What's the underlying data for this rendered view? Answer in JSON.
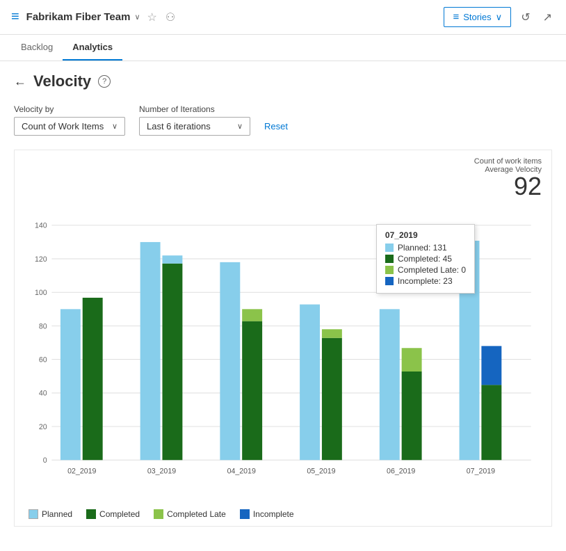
{
  "header": {
    "team_name": "Fabrikam Fiber Team",
    "icon": "≡",
    "chevron": "∨",
    "star": "☆",
    "team_icon": "⚇",
    "stories_label": "Stories",
    "stories_chevron": "∨",
    "refresh_icon": "↺",
    "expand_icon": "↗"
  },
  "nav": {
    "tabs": [
      {
        "id": "backlog",
        "label": "Backlog",
        "active": false
      },
      {
        "id": "analytics",
        "label": "Analytics",
        "active": true
      }
    ]
  },
  "page": {
    "back_label": "←",
    "title": "Velocity",
    "help_label": "?",
    "velocity_by_label": "Velocity by",
    "number_of_iterations_label": "Number of Iterations",
    "velocity_by_value": "Count of Work Items",
    "number_of_iterations_value": "Last 6 iterations",
    "reset_label": "Reset",
    "chart_metric_label": "Count of work items",
    "chart_avg_label": "Average Velocity",
    "chart_avg_value": "92"
  },
  "chart": {
    "y_ticks": [
      0,
      20,
      40,
      60,
      80,
      100,
      120,
      140
    ],
    "groups": [
      {
        "label": "02_2019",
        "planned": 90,
        "completed": 97,
        "completed_late": 0,
        "incomplete": 0
      },
      {
        "label": "03_2019",
        "planned": 130,
        "completed": 117,
        "completed_late": 0,
        "incomplete": 0
      },
      {
        "label": "04_2019",
        "planned": 118,
        "completed": 83,
        "completed_late": 90,
        "incomplete": 0
      },
      {
        "label": "05_2019",
        "planned": 93,
        "completed": 73,
        "completed_late": 78,
        "incomplete": 0
      },
      {
        "label": "06_2019",
        "planned": 90,
        "completed": 53,
        "completed_late": 67,
        "incomplete": 0
      },
      {
        "label": "07_2019",
        "planned": 131,
        "completed": 45,
        "completed_late": 0,
        "incomplete": 23
      }
    ],
    "tooltip": {
      "label": "07_2019",
      "planned": 131,
      "completed": 45,
      "completed_late": 0,
      "incomplete": 23
    },
    "colors": {
      "planned": "#87ceeb",
      "completed": "#1a6b1a",
      "completed_late": "#8bc34a",
      "incomplete": "#1565c0"
    },
    "legend": [
      {
        "id": "planned",
        "label": "Planned",
        "color": "#87ceeb"
      },
      {
        "id": "completed",
        "label": "Completed",
        "color": "#1a6b1a"
      },
      {
        "id": "completed_late",
        "label": "Completed Late",
        "color": "#8bc34a"
      },
      {
        "id": "incomplete",
        "label": "Incomplete",
        "color": "#1565c0"
      }
    ]
  }
}
